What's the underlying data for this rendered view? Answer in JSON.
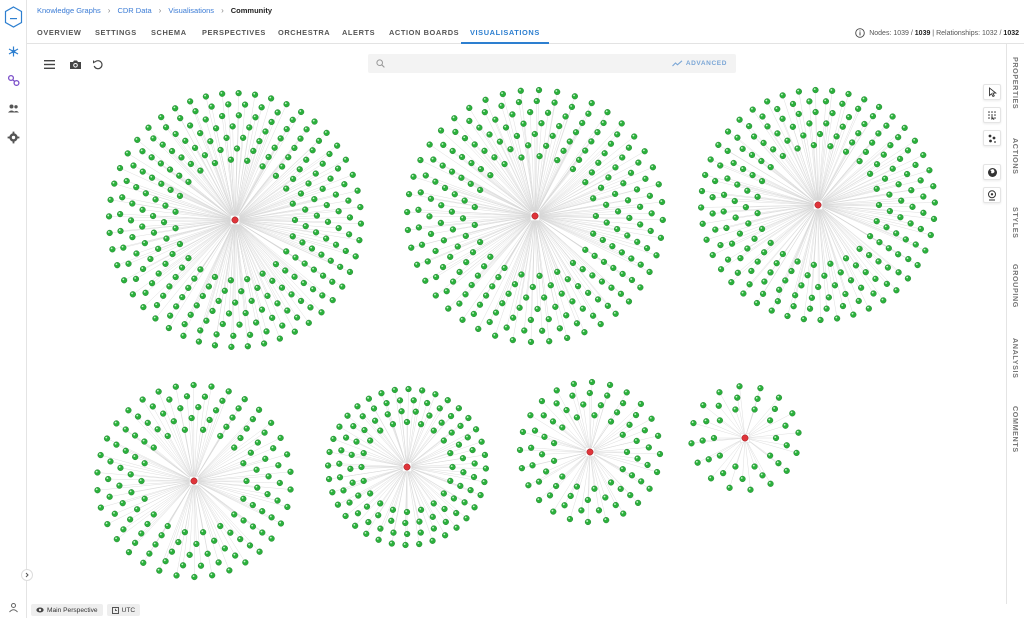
{
  "breadcrumb": [
    "Knowledge Graphs",
    "CDR Data",
    "Visualisations",
    "Community"
  ],
  "tabs": [
    {
      "label": "OVERVIEW"
    },
    {
      "label": "SETTINGS"
    },
    {
      "label": "SCHEMA"
    },
    {
      "label": "PERSPECTIVES"
    },
    {
      "label": "ORCHESTRA"
    },
    {
      "label": "ALERTS"
    },
    {
      "label": "ACTION BOARDS"
    },
    {
      "label": "VISUALISATIONS",
      "active": true
    }
  ],
  "counts": {
    "nodes_label": "Nodes:",
    "nodes_shown": "1039",
    "nodes_total": "1039",
    "relationships_label": "Relationships:",
    "relationships_shown": "1032",
    "relationships_total": "1032"
  },
  "search": {
    "placeholder": "",
    "advanced_label": "ADVANCED"
  },
  "side_tabs": [
    "PROPERTIES",
    "ACTIONS",
    "STYLES",
    "GROUPING",
    "ANALYSIS",
    "COMMENTS"
  ],
  "footer": {
    "perspective": "Main Perspective",
    "timezone": "UTC"
  },
  "colors": {
    "accent": "#2d7fd0",
    "leaf_node": "#2bb03c",
    "hub_node": "#e0343a",
    "edge": "#d6d6d6"
  },
  "icons": {
    "rail": [
      "graph-icon",
      "schema-icon",
      "users-icon",
      "gear-icon"
    ],
    "toolbar": [
      "menu-icon",
      "camera-icon",
      "undo-icon",
      "search-icon"
    ],
    "side_tools": [
      "pointer-icon",
      "lasso-icon",
      "scatter-icon",
      "globe-icon",
      "pin-icon"
    ]
  },
  "communities": [
    {
      "leaves": 246
    },
    {
      "leaves": 230
    },
    {
      "leaves": 200
    },
    {
      "leaves": 130
    },
    {
      "leaves": 112
    },
    {
      "leaves": 75
    },
    {
      "leaves": 39
    }
  ]
}
